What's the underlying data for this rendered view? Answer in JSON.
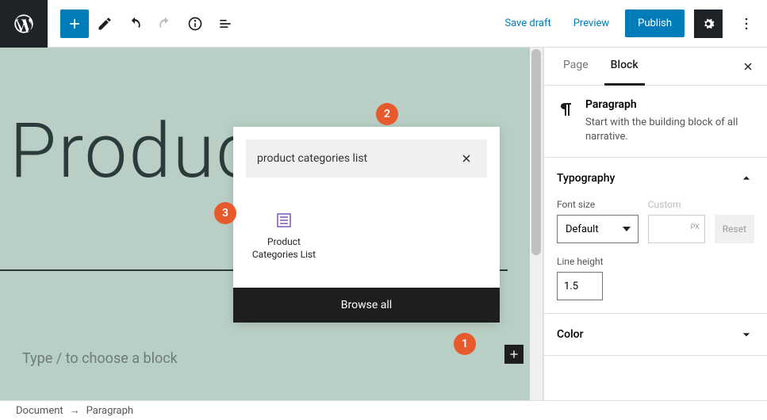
{
  "topbar": {
    "save_draft": "Save draft",
    "preview": "Preview",
    "publish": "Publish"
  },
  "canvas": {
    "title": "Produc",
    "placeholder": "Type / to choose a block"
  },
  "inserter": {
    "search_value": "product categories list",
    "result_label": "Product Categories List",
    "browse_all": "Browse all"
  },
  "badges": {
    "one": "1",
    "two": "2",
    "three": "3"
  },
  "sidebar": {
    "tabs": {
      "page": "Page",
      "block": "Block"
    },
    "block": {
      "title": "Paragraph",
      "desc": "Start with the building block of all narrative."
    },
    "typography": {
      "title": "Typography",
      "font_size_label": "Font size",
      "font_size_value": "Default",
      "custom_label": "Custom",
      "reset": "Reset",
      "line_height_label": "Line height",
      "line_height_value": "1.5"
    },
    "color": {
      "title": "Color"
    }
  },
  "breadcrumb": {
    "root": "Document",
    "sep": "→",
    "leaf": "Paragraph"
  }
}
